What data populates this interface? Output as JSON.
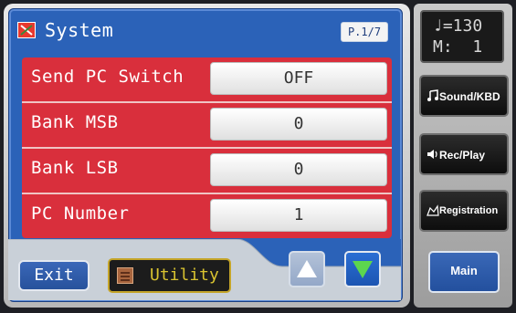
{
  "header": {
    "title": "System",
    "page_indicator": "P.1/7"
  },
  "rows": [
    {
      "label": "Send PC Switch",
      "value": "OFF"
    },
    {
      "label": "Bank MSB",
      "value": "0"
    },
    {
      "label": "Bank LSB",
      "value": "0"
    },
    {
      "label": "PC Number",
      "value": "1"
    }
  ],
  "footer": {
    "exit_label": "Exit",
    "utility_label": "Utility"
  },
  "status": {
    "tempo_line": "♩=130",
    "measure_line": "M:  1"
  },
  "side_buttons": {
    "sound_kbd": "Sound/KBD",
    "rec_play": "Rec/Play",
    "registration": "Registration",
    "main": "Main"
  },
  "colors": {
    "panel_blue": "#2b62b8",
    "list_red": "#d92f3c",
    "utility_gold": "#d9c330",
    "down_arrow_green": "#5cd64e"
  },
  "icons": {
    "title": "system-tools-icon",
    "utility": "utility-icon",
    "sound": "music-note-icon",
    "rec": "speaker-icon",
    "registration": "registration-icon"
  }
}
